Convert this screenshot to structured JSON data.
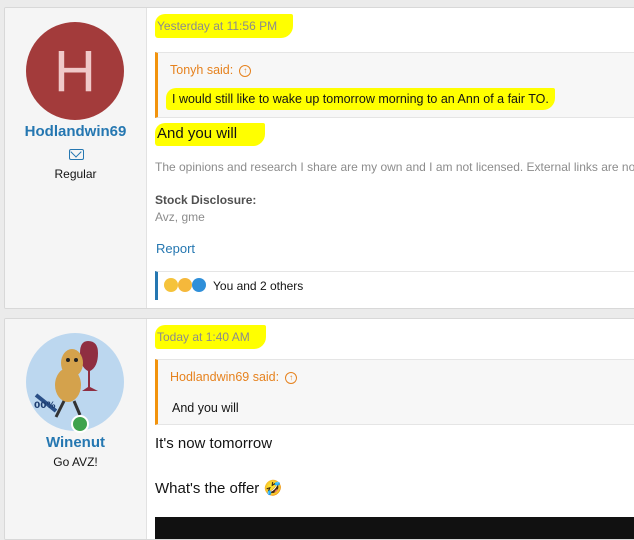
{
  "posts": [
    {
      "avatar_letter": "H",
      "avatar_color": "#a33b3b",
      "username": "Hodlandwin69",
      "user_title": "Regular",
      "date": "Yesterday at 11:56 PM",
      "quote_author": "Tonyh said:",
      "quote_text": "I would still like to wake up tomorrow morning to an Ann of a fair TO.",
      "message": "And you will",
      "signature": "The opinions and research I share are my own and I am not licensed. External links are not I",
      "stock_heading": "Stock Disclosure:",
      "stock_value": "Avz, gme",
      "report_label": "Report",
      "reactions_text": "You and 2 others"
    },
    {
      "avatar_icon": "peanut-wine-icon",
      "username": "Winenut",
      "user_title": "Go AVZ!",
      "date": "Today at 1:40 AM",
      "quote_author": "Hodlandwin69 said:",
      "quote_text": "And you will",
      "message_line1": "It's now tomorrow",
      "message_line2": "What's the offer",
      "message_emoji": "🤣"
    }
  ],
  "highlight_color": "#ffff00",
  "link_color": "#2577b1",
  "quote_accent": "#f2930d"
}
